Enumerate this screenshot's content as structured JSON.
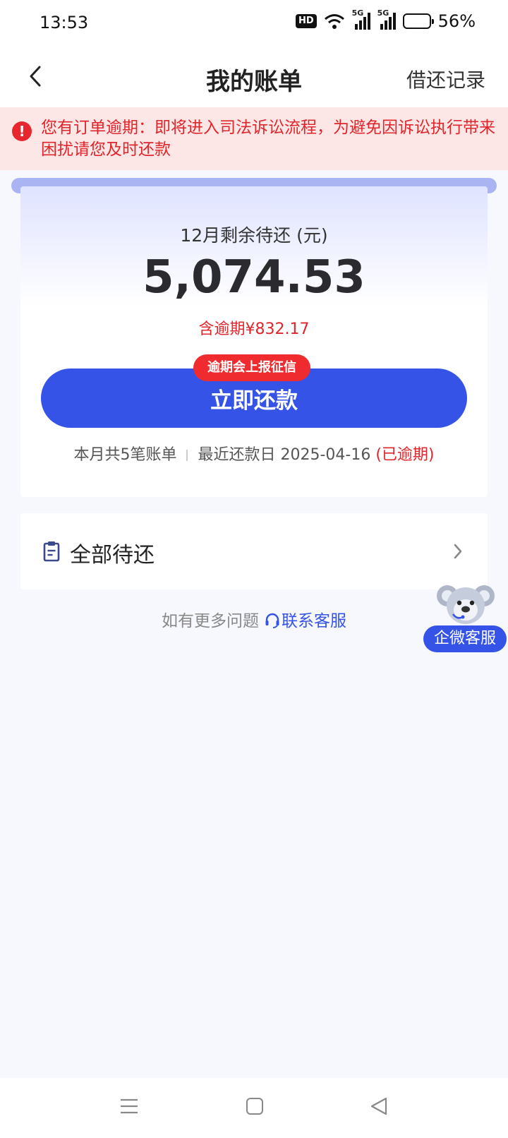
{
  "status_bar": {
    "time": "13:53",
    "hd_label": "HD",
    "network_1": "5G",
    "network_2": "5G",
    "battery_percent": "56%",
    "battery_level": 0.56
  },
  "header": {
    "back_icon": "chevron-left-icon",
    "title": "我的账单",
    "right_link": "借还记录"
  },
  "alert": {
    "icon": "exclamation-icon",
    "text": "您有订单逾期：即将进入司法诉讼流程，为避免因诉讼执行带来困扰请您及时还款"
  },
  "summary": {
    "remain_label": "12月剩余待还 (元)",
    "remain_amount": "5,074.53",
    "overdue_amount": "含逾期¥832.17",
    "credit_badge": "逾期会上报征信",
    "pay_button": "立即还款",
    "bill_count": "本月共5笔账单",
    "recent_due_prefix": "最近还款日 2025-04-16",
    "recent_due_status": "(已逾期)"
  },
  "pending": {
    "icon": "clipboard-icon",
    "label": "全部待还",
    "chevron": "chevron-right-icon"
  },
  "help": {
    "question": "如有更多问题",
    "contact_link": "联系客服"
  },
  "float_service": {
    "label": "企微客服",
    "mascot": "koala-icon"
  },
  "colors": {
    "primary": "#3553e6",
    "danger": "#e0262b",
    "alert_bg": "#fde6e6",
    "page_bg": "#f7f8fd"
  }
}
